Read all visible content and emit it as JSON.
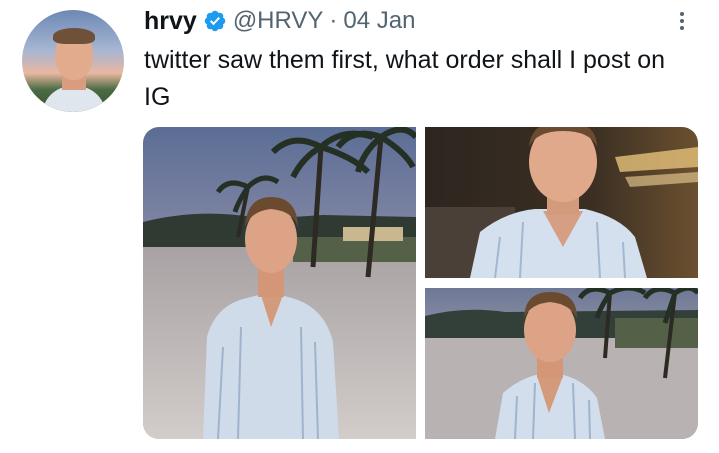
{
  "tweet": {
    "author": {
      "name": "hrvy",
      "handle": "@HRVY",
      "verified": true,
      "verified_color": "#1d9bf0",
      "avatar_icon": "profile-photo"
    },
    "separator": "·",
    "date": "04 Jan",
    "text": "twitter saw them first, what order shall I post on IG",
    "more_icon": "more-vertical-icon",
    "media": [
      {
        "description_icon": "photo-beach-dusk-full"
      },
      {
        "description_icon": "photo-closeup-blurred-lights"
      },
      {
        "description_icon": "photo-beach-dusk-halfbody"
      }
    ]
  },
  "colors": {
    "text_primary": "#0f1419",
    "text_secondary": "#536471",
    "accent": "#1d9bf0",
    "background": "#ffffff"
  }
}
